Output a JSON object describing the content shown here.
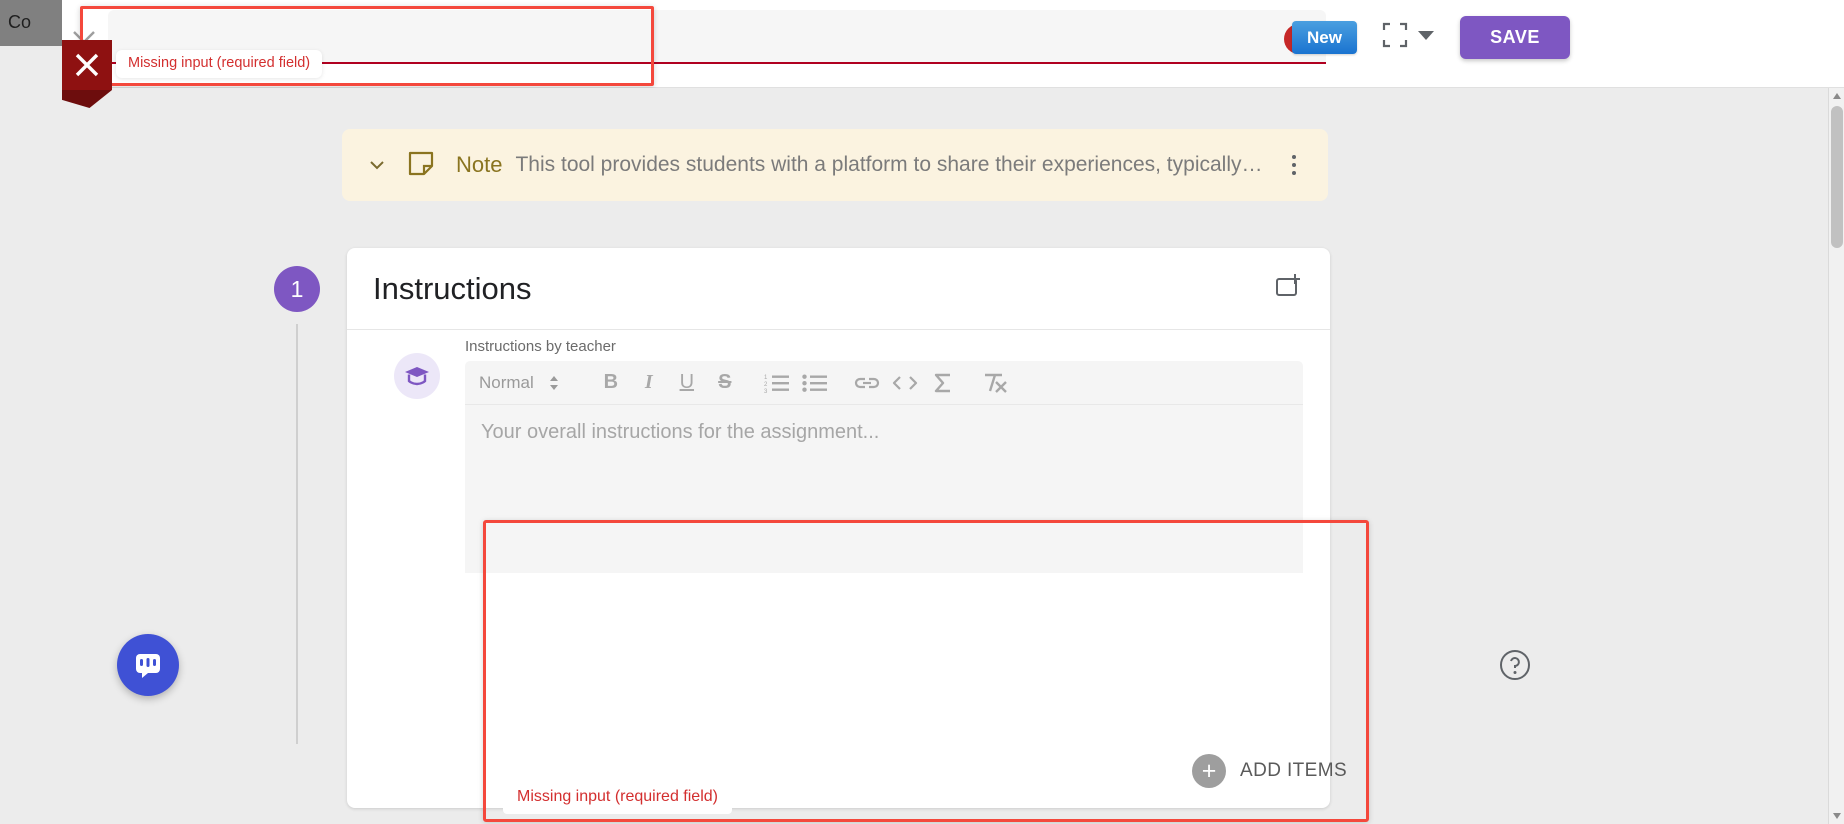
{
  "behind_window": {
    "title": "Co"
  },
  "topbar": {
    "close_icon": "close-icon",
    "title_input_value": "",
    "title_input_placeholder": "",
    "error_icon_glyph": "!",
    "new_button_label": "New",
    "fullscreen_icon": "fullscreen-icon",
    "dropdown_icon": "chevron-down-icon",
    "save_button_label": "SAVE"
  },
  "overlay_badge": {
    "glyph": "✕"
  },
  "validation": {
    "title_message": "Missing input (required field)",
    "editor_message": "Missing input (required field)",
    "outline_color": "#f4483c",
    "text_color": "#d32f2f"
  },
  "note_banner": {
    "collapse_icon": "chevron-down-icon",
    "note_icon": "note-icon",
    "label": "Note",
    "text": "This tool provides students with a platform to share their experiences, typically…",
    "menu_icon": "kebab-menu-icon",
    "background": "#fbf3e0",
    "label_color": "#8a7420"
  },
  "step": {
    "number": "1",
    "color": "#7e57c2"
  },
  "card": {
    "title": "Instructions",
    "add_icon": "add-to-card-icon"
  },
  "editor": {
    "avatar_icon": "graduation-cap-icon",
    "label": "Instructions by teacher",
    "placeholder": "Your overall instructions for the assignment...",
    "content": "",
    "toolbar": {
      "style_value": "Normal",
      "style_selector_icon": "updown-selector-icon",
      "buttons": [
        {
          "name": "bold-button",
          "glyph": "B",
          "kind": "b"
        },
        {
          "name": "italic-button",
          "glyph": "I",
          "kind": "i"
        },
        {
          "name": "underline-button",
          "glyph": "U",
          "kind": "u"
        },
        {
          "name": "strikethrough-button",
          "glyph": "S",
          "kind": "s"
        }
      ],
      "ordered_list_icon": "ordered-list-icon",
      "bullet_list_icon": "bullet-list-icon",
      "link_icon": "link-icon",
      "code_icon": "code-icon",
      "formula_icon": "formula-sigma-icon",
      "clear_format_icon": "clear-formatting-icon"
    }
  },
  "add_items": {
    "label": "ADD ITEMS",
    "icon": "plus-circle-icon"
  },
  "intercom": {
    "icon": "chat-bubble-icon",
    "color": "#3f51d5"
  },
  "help": {
    "icon": "help-circle-icon"
  },
  "scrollbar": {
    "up_icon": "scroll-up-arrow",
    "down_icon": "scroll-down-arrow"
  }
}
